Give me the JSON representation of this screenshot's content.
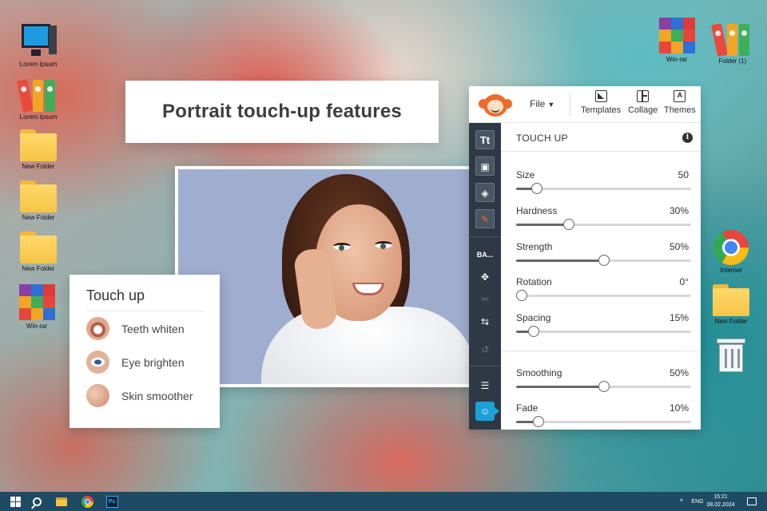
{
  "desktop": {
    "left_icons": [
      {
        "label": "Lorem Ipsum",
        "icon": "monitor-icon"
      },
      {
        "label": "Lorem Ipsum",
        "icon": "binders-icon"
      },
      {
        "label": "New Folder",
        "icon": "folder-icon"
      },
      {
        "label": "New Folder",
        "icon": "folder-icon"
      },
      {
        "label": "New Folder",
        "icon": "folder-icon"
      },
      {
        "label": "Win-rar",
        "icon": "winrar-icon"
      }
    ],
    "right_icons": [
      {
        "label": "Win-rar",
        "icon": "winrar-icon"
      },
      {
        "label": "Folder (1)",
        "icon": "binders-icon"
      },
      {
        "label": "Internet",
        "icon": "chrome-icon"
      },
      {
        "label": "New Folder",
        "icon": "folder-icon"
      },
      {
        "label": "",
        "icon": "recycle-bin-icon"
      }
    ]
  },
  "headline": "Portrait touch-up features",
  "touch_card": {
    "title": "Touch up",
    "items": [
      {
        "label": "Teeth whiten",
        "icon": "teeth-thumb-icon"
      },
      {
        "label": "Eye brighten",
        "icon": "eye-thumb-icon"
      },
      {
        "label": "Skin smoother",
        "icon": "skin-thumb-icon"
      }
    ]
  },
  "editor": {
    "file_menu": "File",
    "top_buttons": [
      {
        "label": "Templates",
        "icon": "templates-icon"
      },
      {
        "label": "Collage",
        "icon": "collage-icon"
      },
      {
        "label": "Themes",
        "icon": "themes-icon"
      }
    ],
    "sidebar": {
      "text_tool": "Tt",
      "basic_tool": "BA..."
    },
    "panel": {
      "title": "TOUCH UP",
      "info_glyph": "i",
      "sliders": [
        {
          "label": "Size",
          "value_text": "50",
          "fraction": 0.12
        },
        {
          "label": "Hardness",
          "value_text": "30%",
          "fraction": 0.3
        },
        {
          "label": "Strength",
          "value_text": "50%",
          "fraction": 0.5
        },
        {
          "label": "Rotation",
          "value_text": "0°",
          "fraction": 0.03
        },
        {
          "label": "Spacing",
          "value_text": "15%",
          "fraction": 0.1
        },
        {
          "label": "Smoothing",
          "value_text": "50%",
          "fraction": 0.5
        },
        {
          "label": "Fade",
          "value_text": "10%",
          "fraction": 0.13
        }
      ]
    }
  },
  "taskbar": {
    "language": "ENG",
    "time": "15:21",
    "date": "08.02.2024",
    "ps_label": "Ps",
    "tray_chevron": "^"
  },
  "colors": {
    "accent": "#1aa1d8",
    "sidebar": "#2f3946",
    "taskbar": "#1f4a63",
    "logo_orange": "#ef6a2a"
  }
}
